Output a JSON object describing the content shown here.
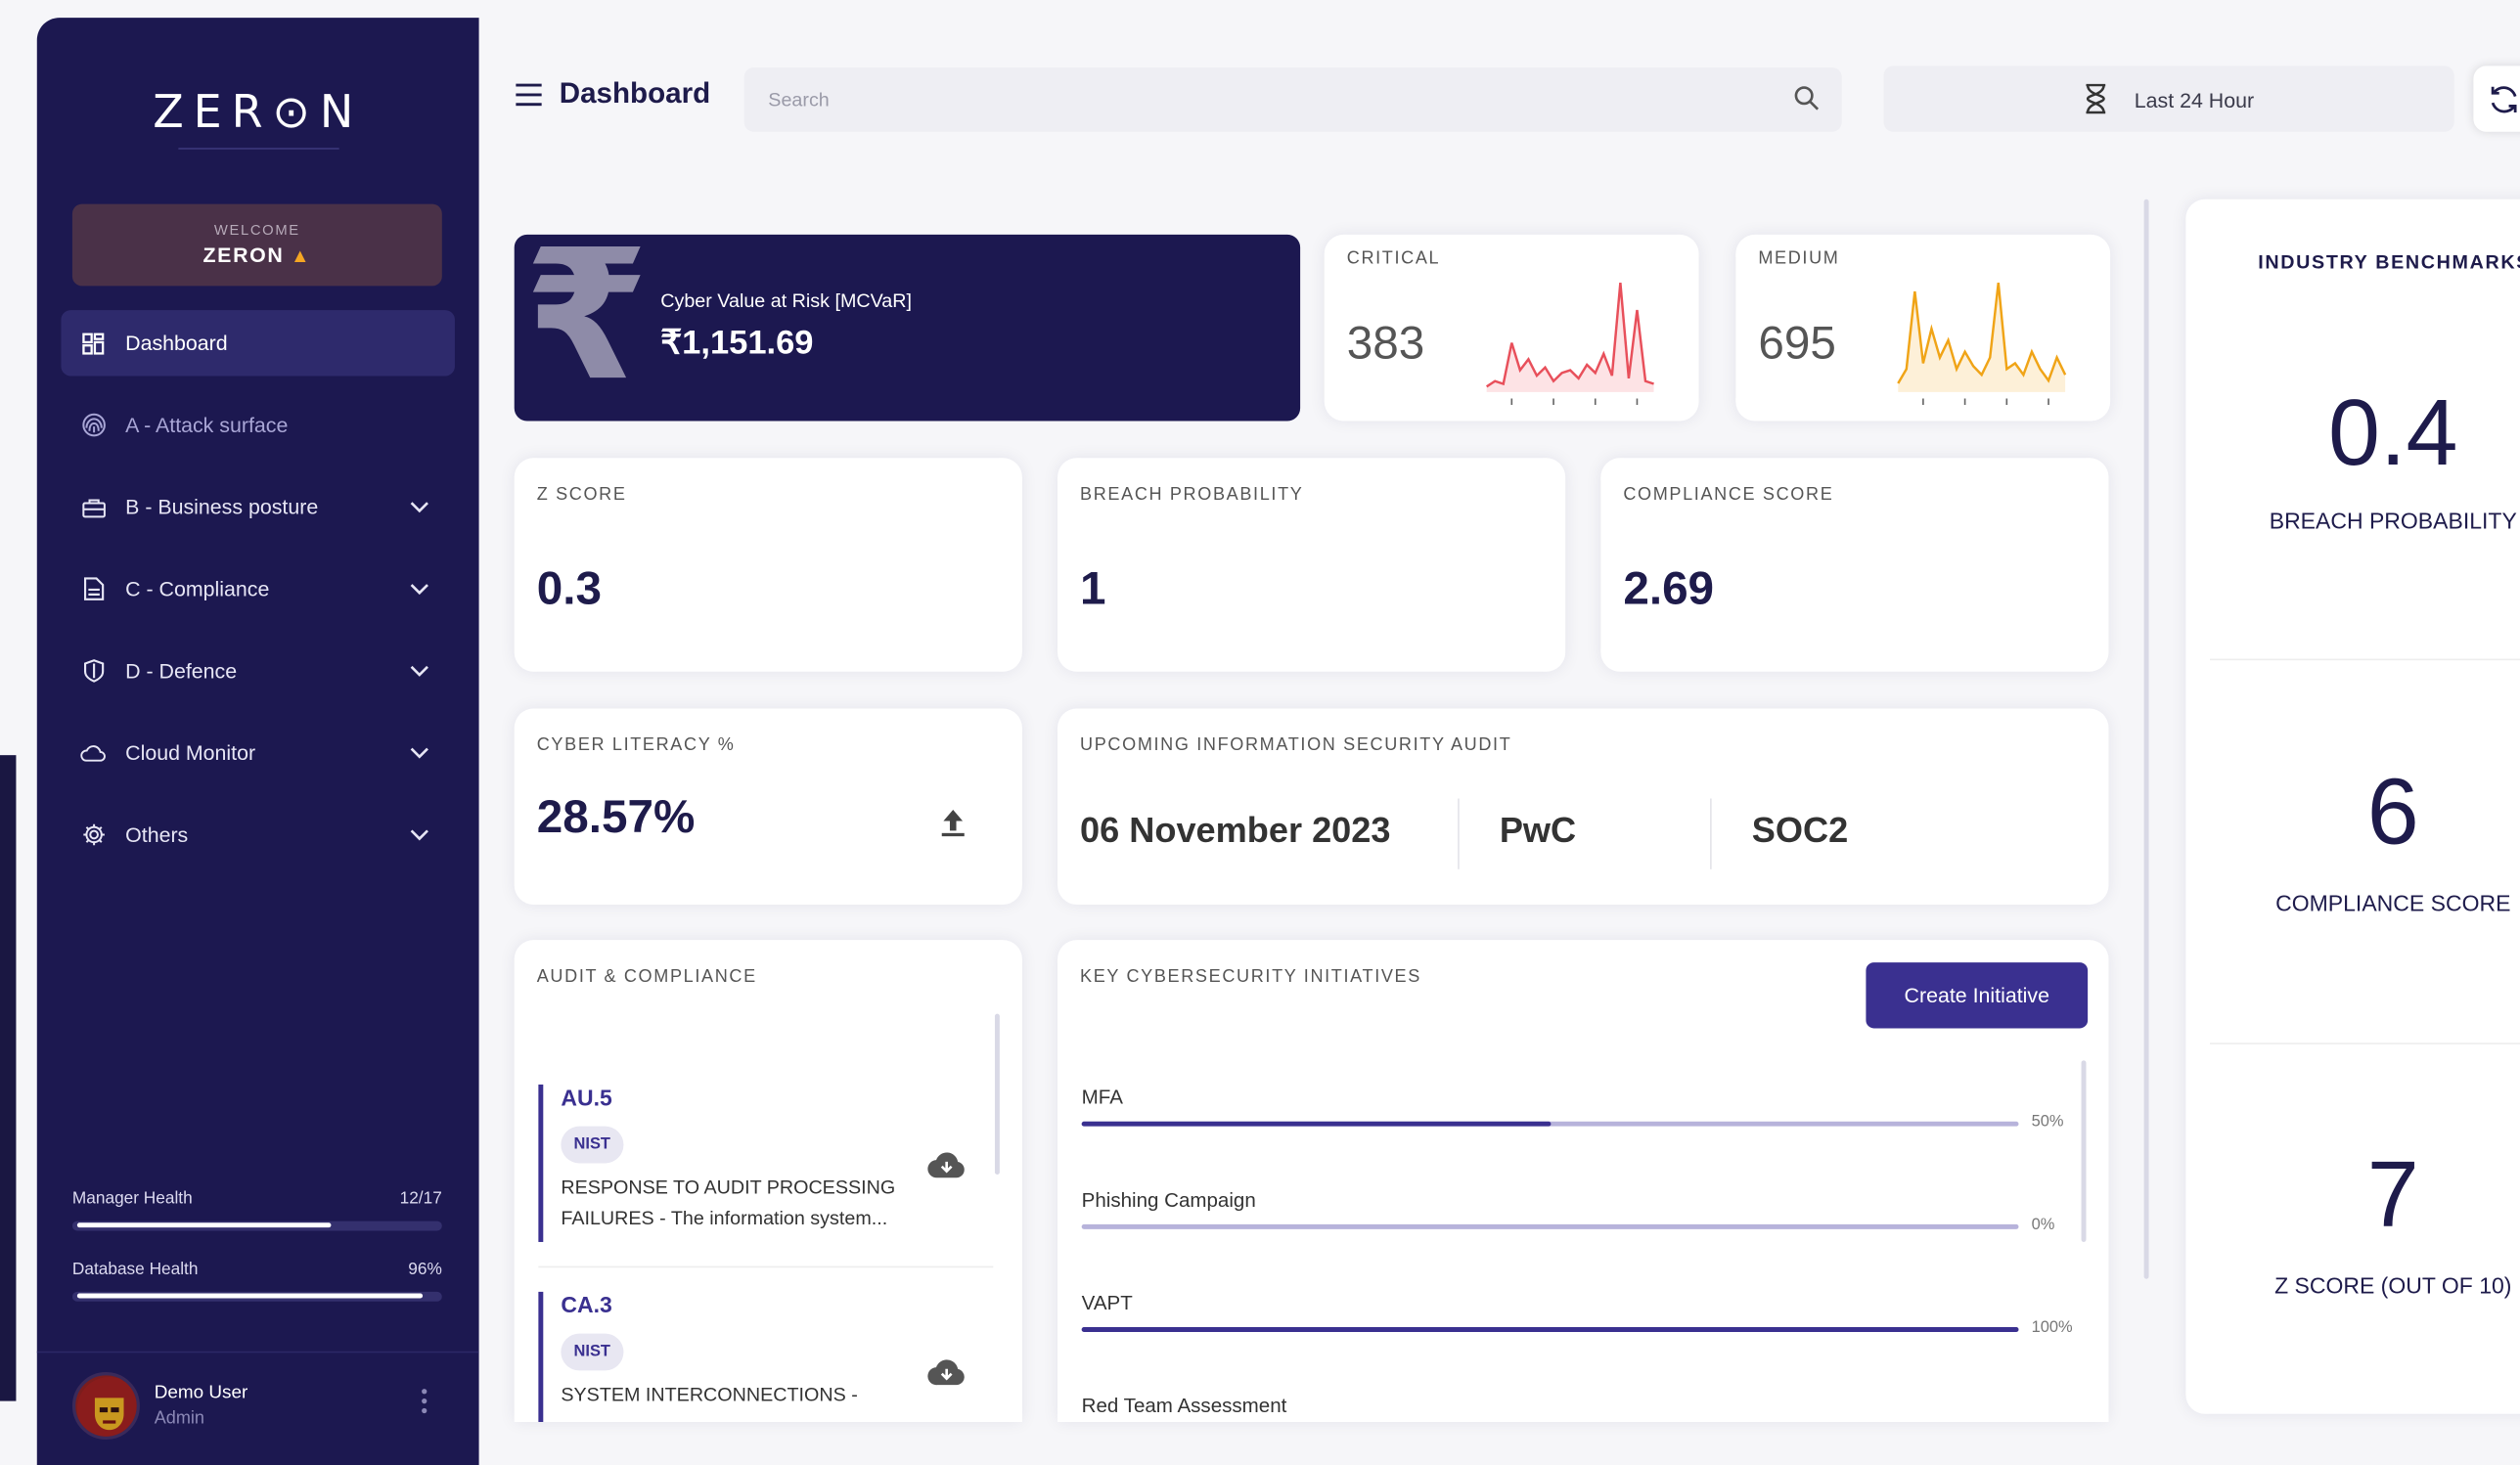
{
  "brand": {
    "logo_text": "ZERON",
    "welcome_label": "WELCOME",
    "welcome_name": "ZERON"
  },
  "header": {
    "title": "Dashboard",
    "search_placeholder": "Search",
    "time_range": "Last 24 Hour"
  },
  "sidebar": {
    "items": [
      {
        "label": "Dashboard",
        "icon": "grid-icon",
        "active": true
      },
      {
        "label": "A - Attack surface",
        "icon": "fingerprint-icon"
      },
      {
        "label": "B - Business posture",
        "icon": "briefcase-icon"
      },
      {
        "label": "C - Compliance",
        "icon": "document-icon"
      },
      {
        "label": "D - Defence",
        "icon": "shield-icon"
      },
      {
        "label": "Cloud Monitor",
        "icon": "cloud-icon"
      },
      {
        "label": "Others",
        "icon": "gear-icon"
      }
    ],
    "manager_health": {
      "label": "Manager Health",
      "value": "12/17",
      "fraction": 0.706
    },
    "database_health": {
      "label": "Database Health",
      "value": "96%",
      "fraction": 0.96
    },
    "user": {
      "name": "Demo User",
      "role": "Admin"
    }
  },
  "cards": {
    "cvar": {
      "title": "Cyber Value at Risk [MCVaR]",
      "value": "₹1,151.69",
      "icon": "rupee-icon"
    },
    "critical": {
      "label": "CRITICAL",
      "value": "383",
      "color": "#e8505b",
      "fill": "#fde3e5",
      "series": [
        2,
        4,
        3,
        18,
        8,
        12,
        6,
        9,
        4,
        7,
        8,
        5,
        10,
        7,
        14,
        6,
        40,
        5,
        30,
        4,
        3
      ]
    },
    "medium": {
      "label": "MEDIUM",
      "value": "695",
      "color": "#f0a417",
      "fill": "#fdf0d8",
      "series": [
        3,
        8,
        35,
        10,
        22,
        12,
        18,
        8,
        14,
        9,
        6,
        12,
        38,
        8,
        10,
        6,
        14,
        8,
        4,
        12,
        6
      ]
    },
    "z_score": {
      "label": "Z SCORE",
      "value": "0.3"
    },
    "breach_probability": {
      "label": "BREACH PROBABILITY",
      "value": "1"
    },
    "compliance_score": {
      "label": "COMPLIANCE SCORE",
      "value": "2.69"
    },
    "cyber_literacy": {
      "label": "CYBER LITERACY %",
      "value": "28.57%"
    },
    "audit": {
      "label": "UPCOMING INFORMATION SECURITY AUDIT",
      "date": "06 November 2023",
      "auditor": "PwC",
      "standard": "SOC2"
    }
  },
  "audit_compliance": {
    "label": "AUDIT & COMPLIANCE",
    "items": [
      {
        "code": "AU.5",
        "tag": "NIST",
        "desc1": "RESPONSE TO AUDIT PROCESSING",
        "desc2": "FAILURES - The information system..."
      },
      {
        "code": "CA.3",
        "tag": "NIST",
        "desc1": "SYSTEM INTERCONNECTIONS -",
        "desc2": ""
      }
    ]
  },
  "initiatives": {
    "label": "KEY CYBERSECURITY INITIATIVES",
    "button": "Create Initiative",
    "items": [
      {
        "name": "MFA",
        "percent": "50%",
        "fraction": 0.5
      },
      {
        "name": "Phishing Campaign",
        "percent": "0%",
        "fraction": 0
      },
      {
        "name": "VAPT",
        "percent": "100%",
        "fraction": 1
      },
      {
        "name": "Red Team Assessment"
      }
    ]
  },
  "benchmarks": {
    "title": "INDUSTRY BENCHMARKS",
    "items": [
      {
        "value": "0.4",
        "label": "BREACH PROBABILITY"
      },
      {
        "value": "6",
        "label": "COMPLIANCE SCORE"
      },
      {
        "value": "7",
        "label": "Z SCORE (OUT OF 10)"
      }
    ]
  }
}
